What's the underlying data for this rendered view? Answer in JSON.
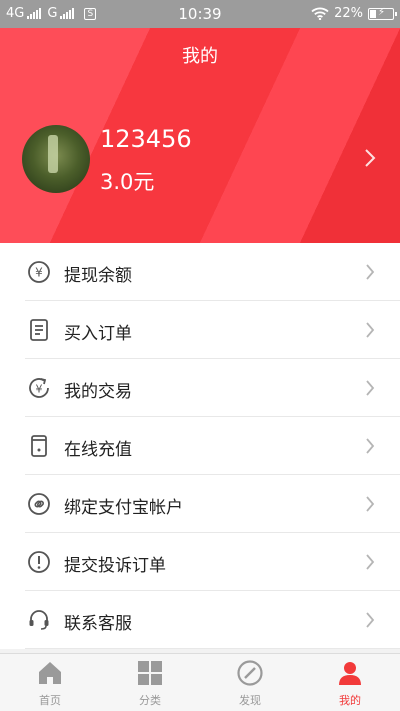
{
  "status_bar": {
    "network_1": "4G",
    "network_2": "G",
    "sim_label": "S",
    "time": "10:39",
    "battery": "22%"
  },
  "header": {
    "title": "我的"
  },
  "profile": {
    "username": "123456",
    "balance": "3.0元"
  },
  "menu": {
    "items": [
      {
        "label": "提现余额",
        "icon": "yuan-circle-icon"
      },
      {
        "label": "买入订单",
        "icon": "document-icon"
      },
      {
        "label": "我的交易",
        "icon": "exchange-icon"
      },
      {
        "label": "在线充值",
        "icon": "phone-icon"
      },
      {
        "label": "绑定支付宝帐户",
        "icon": "link-icon"
      },
      {
        "label": "提交投诉订单",
        "icon": "alert-icon"
      },
      {
        "label": "联系客服",
        "icon": "headset-icon"
      }
    ]
  },
  "tabbar": {
    "tabs": [
      {
        "label": "首页",
        "icon": "home-icon"
      },
      {
        "label": "分类",
        "icon": "grid-icon"
      },
      {
        "label": "发现",
        "icon": "compass-icon"
      },
      {
        "label": "我的",
        "icon": "user-icon",
        "active": true
      }
    ]
  },
  "colors": {
    "header_red": "#f7373f",
    "accent_red": "#f23a3a",
    "icon_gray": "#666666",
    "chevron_gray": "#b5b5b5"
  }
}
